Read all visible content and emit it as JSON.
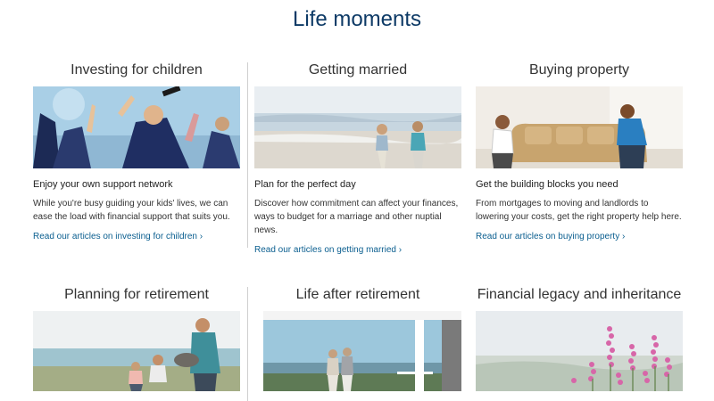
{
  "page": {
    "title": "Life moments"
  },
  "cards": [
    {
      "title": "Investing for children",
      "subtitle": "Enjoy your own support network",
      "description": "While you're busy guiding your kids' lives, we can ease the load with financial support that suits you.",
      "link": "Read our articles on investing for children ›"
    },
    {
      "title": "Getting married",
      "subtitle": "Plan for the perfect day",
      "description": "Discover how commitment can affect your finances, ways to budget for a marriage and other nuptial news.",
      "link": "Read our articles on getting married ›"
    },
    {
      "title": "Buying property",
      "subtitle": "Get the building blocks you need",
      "description": "From mortgages to moving and landlords to lowering your costs, get the right property help here.",
      "link": "Read our articles on buying property ›"
    },
    {
      "title": "Planning for retirement"
    },
    {
      "title": "Life after retirement"
    },
    {
      "title": "Financial legacy and inheritance"
    }
  ],
  "colors": {
    "title": "#0d3a66",
    "link": "#0a5e8f",
    "divider": "#cfcfcf"
  }
}
